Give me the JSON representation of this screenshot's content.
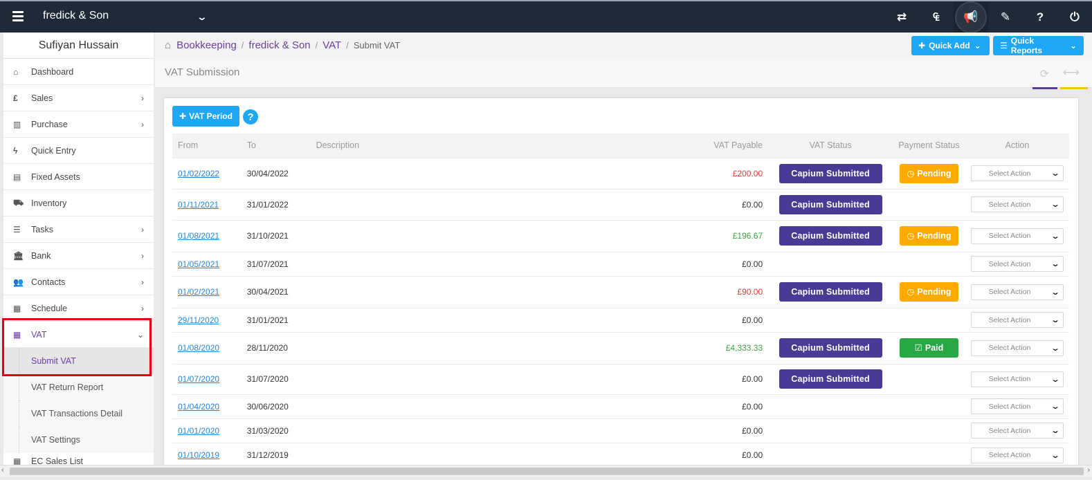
{
  "topbar": {
    "company": "fredick & Son",
    "icons": [
      "exchange-icon",
      "capium-icon",
      "megaphone-icon",
      "tag-icon",
      "help-icon",
      "power-icon"
    ]
  },
  "sidebar": {
    "user_name": "Sufiyan Hussain",
    "items": [
      {
        "label": "Dashboard",
        "icon": "home-icon"
      },
      {
        "label": "Sales",
        "icon": "pound-icon"
      },
      {
        "label": "Purchase",
        "icon": "barcode-icon"
      },
      {
        "label": "Quick Entry",
        "icon": "bolt-icon"
      },
      {
        "label": "Fixed Assets",
        "icon": "building-icon"
      },
      {
        "label": "Inventory",
        "icon": "truck-icon"
      },
      {
        "label": "Tasks",
        "icon": "list-icon"
      },
      {
        "label": "Bank",
        "icon": "bank-icon"
      },
      {
        "label": "Contacts",
        "icon": "users-icon"
      },
      {
        "label": "Schedule",
        "icon": "calendar-icon"
      },
      {
        "label": "VAT",
        "icon": "calculator-icon"
      }
    ],
    "vat_sub": [
      {
        "label": "Submit VAT"
      },
      {
        "label": "VAT Return Report"
      },
      {
        "label": "VAT Transactions Detail"
      },
      {
        "label": "VAT Settings"
      }
    ],
    "partial_item": "EC Sales List"
  },
  "breadcrumb": {
    "items": [
      "Bookkeeping",
      "fredick & Son",
      "VAT"
    ],
    "current": "Submit VAT"
  },
  "header_buttons": {
    "quick_add": "Quick Add",
    "quick_reports": "Quick Reports"
  },
  "page_title": "VAT Submission",
  "panel": {
    "vat_period_button": "VAT Period",
    "help_label": "?"
  },
  "table": {
    "headers": {
      "from": "From",
      "to": "To",
      "description": "Description",
      "vat_payable": "VAT Payable",
      "vat_status": "VAT Status",
      "payment_status": "Payment Status",
      "action": "Action"
    },
    "action_placeholder": "Select Action",
    "rows": [
      {
        "from": "01/02/2022",
        "to": "30/04/2022",
        "description": "",
        "payable": "£200.00",
        "tone": "neg",
        "vat_status": "Capium Submitted",
        "payment": "Pending"
      },
      {
        "from": "01/11/2021",
        "to": "31/01/2022",
        "description": "",
        "payable": "£0.00",
        "tone": "",
        "vat_status": "Capium Submitted",
        "payment": ""
      },
      {
        "from": "01/08/2021",
        "to": "31/10/2021",
        "description": "",
        "payable": "£196.67",
        "tone": "pos",
        "vat_status": "Capium Submitted",
        "payment": "Pending"
      },
      {
        "from": "01/05/2021",
        "to": "31/07/2021",
        "description": "",
        "payable": "£0.00",
        "tone": "",
        "vat_status": "",
        "payment": ""
      },
      {
        "from": "01/02/2021",
        "to": "30/04/2021",
        "description": "",
        "payable": "£90.00",
        "tone": "neg",
        "vat_status": "Capium Submitted",
        "payment": "Pending"
      },
      {
        "from": "29/11/2020",
        "to": "31/01/2021",
        "description": "",
        "payable": "£0.00",
        "tone": "",
        "vat_status": "",
        "payment": ""
      },
      {
        "from": "01/08/2020",
        "to": "28/11/2020",
        "description": "",
        "payable": "£4,333.33",
        "tone": "pos",
        "vat_status": "Capium Submitted",
        "payment": "Paid"
      },
      {
        "from": "01/07/2020",
        "to": "31/07/2020",
        "description": "",
        "payable": "£0.00",
        "tone": "",
        "vat_status": "Capium Submitted",
        "payment": ""
      },
      {
        "from": "01/04/2020",
        "to": "30/06/2020",
        "description": "",
        "payable": "£0.00",
        "tone": "",
        "vat_status": "",
        "payment": ""
      },
      {
        "from": "01/01/2020",
        "to": "31/03/2020",
        "description": "",
        "payable": "£0.00",
        "tone": "",
        "vat_status": "",
        "payment": ""
      },
      {
        "from": "01/10/2019",
        "to": "31/12/2019",
        "description": "",
        "payable": "£0.00",
        "tone": "",
        "vat_status": "",
        "payment": ""
      }
    ]
  },
  "colors": {
    "topbar": "#1e2a38",
    "accent_blue": "#1ea7f5",
    "status_purple": "#4a3a95",
    "pending": "#ffaa00",
    "paid": "#28a745",
    "highlight_red": "#e3000f"
  }
}
